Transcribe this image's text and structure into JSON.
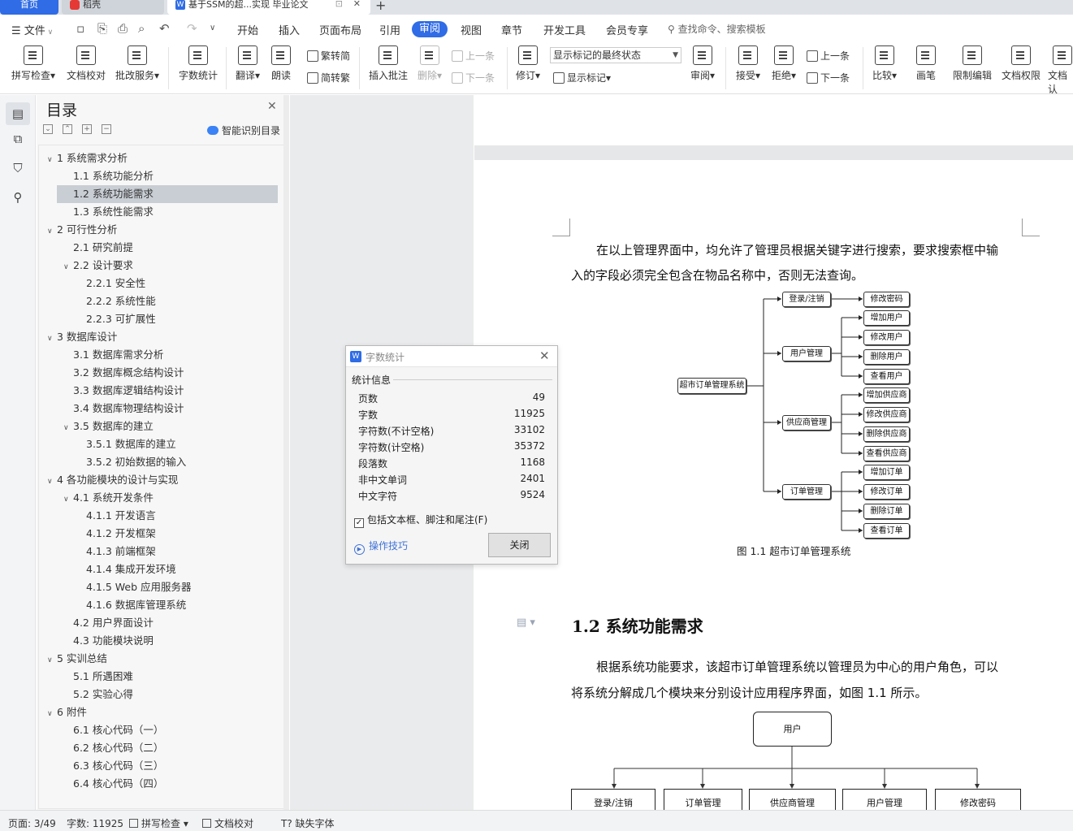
{
  "tabs": {
    "home": "首页",
    "dk": "稻壳",
    "doc": "基于SSM的超...实现 毕业论文"
  },
  "menu": {
    "file": "文件",
    "items": [
      "开始",
      "插入",
      "页面布局",
      "引用",
      "审阅",
      "视图",
      "章节",
      "开发工具",
      "会员专享"
    ],
    "active": "审阅",
    "search": "查找命令、搜索模板"
  },
  "ribbon": {
    "spell": "拼写检查",
    "proof": "文档校对",
    "batch": "批改服务",
    "wordcount": "字数统计",
    "translate": "翻译",
    "read": "朗读",
    "to_simplified": "繁转简",
    "to_traditional": "简转繁",
    "insert_comment": "插入批注",
    "delete": "删除",
    "prev_comment": "上一条",
    "next_comment": "下一条",
    "track": "修订",
    "markup_state": "显示标记的最终状态",
    "show_markup": "显示标记",
    "review": "审阅",
    "accept": "接受",
    "reject": "拒绝",
    "prev_change": "上一条",
    "next_change": "下一条",
    "compare": "比较",
    "pen": "画笔",
    "restrict": "限制编辑",
    "doc_perm": "文档权限",
    "doc_auth": "文档认"
  },
  "toc": {
    "title": "目录",
    "smart": "智能识别目录",
    "items": [
      {
        "label": "1  系统需求分析",
        "level": 1,
        "arrow": "∨"
      },
      {
        "label": "1.1  系统功能分析",
        "level": 2
      },
      {
        "label": "1.2  系统功能需求",
        "level": 2,
        "selected": true
      },
      {
        "label": "1.3  系统性能需求",
        "level": 2
      },
      {
        "label": "2  可行性分析",
        "level": 1,
        "arrow": "∨"
      },
      {
        "label": "2.1  研究前提",
        "level": 2
      },
      {
        "label": "2.2  设计要求",
        "level": 2,
        "arrow": "∨"
      },
      {
        "label": "2.2.1  安全性",
        "level": 3
      },
      {
        "label": "2.2.2  系统性能",
        "level": 3
      },
      {
        "label": "2.2.3  可扩展性",
        "level": 3
      },
      {
        "label": "3  数据库设计",
        "level": 1,
        "arrow": "∨"
      },
      {
        "label": "3.1  数据库需求分析",
        "level": 2
      },
      {
        "label": "3.2  数据库概念结构设计",
        "level": 2
      },
      {
        "label": "3.3  数据库逻辑结构设计",
        "level": 2
      },
      {
        "label": "3.4  数据库物理结构设计",
        "level": 2
      },
      {
        "label": "3.5  数据库的建立",
        "level": 2,
        "arrow": "∨"
      },
      {
        "label": "3.5.1  数据库的建立",
        "level": 3
      },
      {
        "label": "3.5.2  初始数据的输入",
        "level": 3
      },
      {
        "label": "4  各功能模块的设计与实现",
        "level": 1,
        "arrow": "∨"
      },
      {
        "label": "4.1  系统开发条件",
        "level": 2,
        "arrow": "∨"
      },
      {
        "label": "4.1.1  开发语言",
        "level": 3
      },
      {
        "label": "4.1.2  开发框架",
        "level": 3
      },
      {
        "label": "4.1.3  前端框架",
        "level": 3
      },
      {
        "label": "4.1.4  集成开发环境",
        "level": 3
      },
      {
        "label": "4.1.5 Web 应用服务器",
        "level": 3
      },
      {
        "label": "4.1.6  数据库管理系统",
        "level": 3
      },
      {
        "label": "4.2  用户界面设计",
        "level": 2
      },
      {
        "label": "4.3  功能模块说明",
        "level": 2
      },
      {
        "label": "5  实训总结",
        "level": 1,
        "arrow": "∨"
      },
      {
        "label": "5.1  所遇困难",
        "level": 2
      },
      {
        "label": "5.2  实验心得",
        "level": 2
      },
      {
        "label": "6  附件",
        "level": 1,
        "arrow": "∨"
      },
      {
        "label": "6.1  核心代码（一）",
        "level": 2
      },
      {
        "label": "6.2  核心代码（二）",
        "level": 2
      },
      {
        "label": "6.3  核心代码（三）",
        "level": 2
      },
      {
        "label": "6.4  核心代码（四）",
        "level": 2
      }
    ]
  },
  "document": {
    "para1_line1": "在以上管理界面中，均允许了管理员根据关键字进行搜索，要求搜索框中输",
    "para1_line2": "入的字段必须完全包含在物品名称中，否则无法查询。",
    "fig1": {
      "root": "超市订单管理系统",
      "branches": [
        {
          "label": "登录/注销",
          "children": [
            "修改密码"
          ]
        },
        {
          "label": "用户管理",
          "children": [
            "增加用户",
            "修改用户",
            "删除用户",
            "查看用户"
          ]
        },
        {
          "label": "供应商管理",
          "children": [
            "增加供应商",
            "修改供应商",
            "删除供应商",
            "查看供应商"
          ]
        },
        {
          "label": "订单管理",
          "children": [
            "增加订单",
            "修改订单",
            "删除订单",
            "查看订单"
          ]
        }
      ],
      "caption": "图 1.1  超市订单管理系统"
    },
    "heading": "1.2  系统功能需求",
    "para2_line1": "根据系统功能要求，该超市订单管理系统以管理员为中心的用户角色，可以",
    "para2_line2": "将系统分解成几个模块来分别设计应用程序界面，如图  1.1 所示。",
    "fig2": {
      "root": "用户",
      "children": [
        "登录/注销",
        "订单管理",
        "供应商管理",
        "用户管理",
        "修改密码"
      ]
    }
  },
  "dialog": {
    "title": "字数统计",
    "section": "统计信息",
    "rows": [
      {
        "label": "页数",
        "value": "49"
      },
      {
        "label": "字数",
        "value": "11925"
      },
      {
        "label": "字符数(不计空格)",
        "value": "33102"
      },
      {
        "label": "字符数(计空格)",
        "value": "35372"
      },
      {
        "label": "段落数",
        "value": "1168"
      },
      {
        "label": "非中文单词",
        "value": "2401"
      },
      {
        "label": "中文字符",
        "value": "9524"
      }
    ],
    "include_label": "包括文本框、脚注和尾注(F)",
    "include_checked": true,
    "tips": "操作技巧",
    "close": "关闭"
  },
  "status": {
    "page": "页面: 3/49",
    "words": "字数: 11925",
    "spell": "拼写检查",
    "proof": "文档校对",
    "font_missing": "缺失字体"
  },
  "colors": {
    "accent": "#2f6ce5",
    "link": "#3f72d8",
    "selected_row": "#c9ced5"
  }
}
